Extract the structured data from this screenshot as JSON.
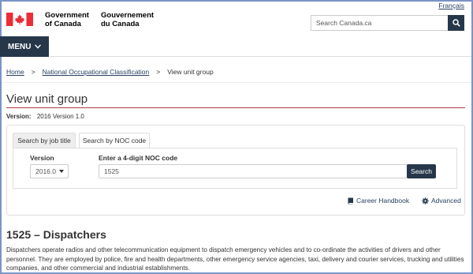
{
  "header": {
    "language_link": "Français",
    "wordmark_en_line1": "Government",
    "wordmark_en_line2": "of Canada",
    "wordmark_fr_line1": "Gouvernement",
    "wordmark_fr_line2": "du Canada",
    "search_placeholder": "Search Canada.ca",
    "search_icon": "search-icon",
    "flag_color": "#eb2d37"
  },
  "menu": {
    "label": "MENU",
    "icon": "chevron-down-icon"
  },
  "breadcrumb": {
    "items": [
      "Home",
      "National Occupational Classification"
    ],
    "current": "View unit group",
    "separator": ">"
  },
  "page": {
    "title": "View unit group",
    "version_label": "Version:",
    "version_value": "2016 Version 1.0"
  },
  "search_panel": {
    "tabs": [
      {
        "label": "Search by job title",
        "active": false
      },
      {
        "label": "Search by NOC code",
        "active": true
      }
    ],
    "version_label": "Version",
    "version_value": "2016.0",
    "noc_label": "Enter a 4-digit NOC code",
    "noc_value": "1525",
    "submit_label": "Search",
    "career_handbook_label": "Career Handbook",
    "career_handbook_icon": "book-icon",
    "advanced_label": "Advanced",
    "advanced_icon": "gear-icon"
  },
  "result": {
    "title": "1525 – Dispatchers",
    "description": "Dispatchers operate radios and other telecommunication equipment to dispatch emergency vehicles and to co-ordinate the activities of drivers and other personnel. They are employed by police, fire and health departments, other emergency service agencies, taxi, delivery and courier services, trucking and utilities companies, and other commercial and industrial establishments."
  },
  "colors": {
    "accent_dark": "#26374a",
    "link": "#284162",
    "title_rule": "#af3c43"
  }
}
